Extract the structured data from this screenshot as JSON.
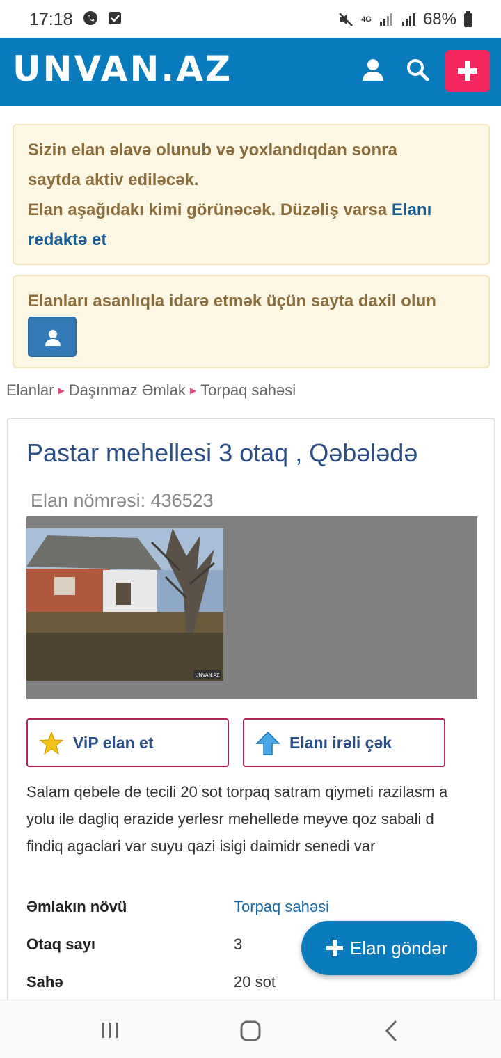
{
  "status_bar": {
    "time": "17:18",
    "battery": "68%",
    "network": "4G"
  },
  "header": {
    "logo": "UNVAN.AZ",
    "icons": [
      "user-icon",
      "search-icon",
      "plus-icon"
    ],
    "accent": "#0a7bbd",
    "add_color": "#f3265f"
  },
  "notice1": {
    "line1": "Sizin elan əlavə olunub və yoxlandıqdan sonra",
    "line2": "saytda aktiv ediləcək.",
    "line3": "Elan aşağıdakı kimi görünəcək. Düzəliş varsa",
    "link_part1": "Elanı",
    "link_part2": "redaktə et"
  },
  "notice2": {
    "text": "Elanları asanlıqla idarə etmək üçün sayta daxil olun"
  },
  "breadcrumb": [
    "Elanlar",
    "Daşınmaz Əmlak",
    "Torpaq sahəsi"
  ],
  "listing": {
    "title": "Pastar mehellesi 3 otaq , Qəbələdə",
    "elan_no": "Elan nömrəsi: 436523",
    "watermark": "UNVAN.AZ",
    "vip_label": "ViP elan et",
    "up_label": "Elanı irəli çək",
    "description": "Salam qebele de tecili 20 sot torpaq satram qiymeti razilasm a yolu ile dagliq erazide yerlesr mehellede meyve qoz sabali d findiq agaclari var suyu qazi isigi daimidr senedi var",
    "properties": [
      {
        "key": "Əmlakın növü",
        "value": "Torpaq sahəsi"
      },
      {
        "key": "Otaq sayı",
        "value": "3"
      },
      {
        "key": "Sahə",
        "value": "20 sot"
      }
    ]
  },
  "fab": {
    "label": "Elan göndər"
  }
}
